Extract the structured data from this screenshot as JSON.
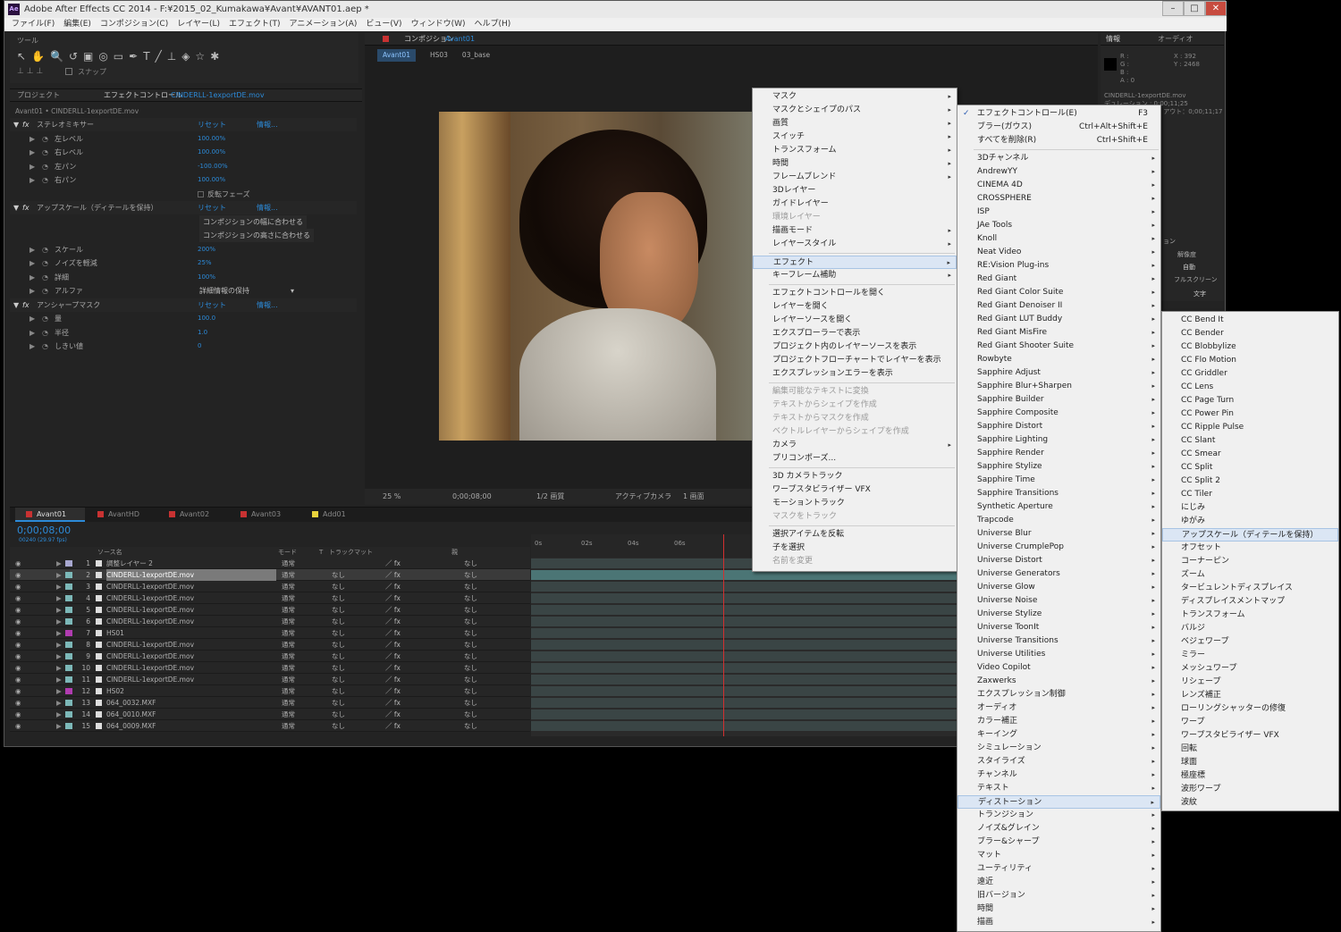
{
  "window": {
    "title": "Adobe After Effects CC 2014 - F:¥2015_02_Kumakawa¥Avant¥AVANT01.aep *",
    "logo": "Ae"
  },
  "menubar": [
    "ファイル(F)",
    "編集(E)",
    "コンポジション(C)",
    "レイヤー(L)",
    "エフェクト(T)",
    "アニメーション(A)",
    "ビュー(V)",
    "ウィンドウ(W)",
    "ヘルプ(H)"
  ],
  "tools": {
    "title": "ツール",
    "snap": "スナップ"
  },
  "project": {
    "tab": "プロジェクト",
    "effect_tab": "エフェクトコントロール",
    "effect_file": "CINDERLL-1exportDE.mov",
    "breadcrumb": "Avant01 • CINDERLL-1exportDE.mov"
  },
  "effects": {
    "reset": "リセット",
    "info": "情報...",
    "rows": [
      {
        "label": "ステレオミキサー",
        "value": "",
        "indent": 0,
        "fx": true
      },
      {
        "label": "左レベル",
        "value": "100.00%",
        "indent": 1
      },
      {
        "label": "右レベル",
        "value": "100.00%",
        "indent": 1
      },
      {
        "label": "左パン",
        "value": "-100.00%",
        "indent": 1
      },
      {
        "label": "右パン",
        "value": "100.00%",
        "indent": 1
      },
      {
        "label": "",
        "value": "反転フェーズ",
        "indent": 1,
        "check": true
      },
      {
        "label": "アップスケール（ディテールを保持）",
        "value": "",
        "indent": 0,
        "fx": true
      },
      {
        "label": "",
        "value": "コンポジションの幅に合わせる",
        "indent": 1,
        "btn": true
      },
      {
        "label": "",
        "value": "コンポジションの高さに合わせる",
        "indent": 1,
        "btn": true
      },
      {
        "label": "スケール",
        "value": "200%",
        "indent": 1
      },
      {
        "label": "ノイズを軽減",
        "value": "25%",
        "indent": 1
      },
      {
        "label": "詳細",
        "value": "100%",
        "indent": 1
      },
      {
        "label": "アルファ",
        "value": "詳細情報の保持",
        "indent": 1,
        "dropdown": true
      },
      {
        "label": "アンシャープマスク",
        "value": "",
        "indent": 0,
        "fx": true
      },
      {
        "label": "量",
        "value": "100.0",
        "indent": 1
      },
      {
        "label": "半径",
        "value": "1.0",
        "indent": 1
      },
      {
        "label": "しきい値",
        "value": "0",
        "indent": 1
      }
    ]
  },
  "comp": {
    "tab": "コンポジション",
    "name": "Avant01",
    "crumbs": [
      "Avant01",
      "HS03",
      "03_base"
    ],
    "zoom": "25 %",
    "time": "0;00;08;00",
    "res": "1/2 画質",
    "camera": "アクティブカメラ",
    "view": "1 画面"
  },
  "info": {
    "tab": "情報",
    "audio_tab": "オーディオ",
    "r": "R :",
    "g": "G :",
    "b": "B :",
    "a": "A : 0",
    "x": "X : 392",
    "y": "Y : 2468",
    "file": "CINDERLL-1exportDE.mov",
    "dur": "デュレーション : 0;00;11;25",
    "in_out": "イン：0;00;00;00、アウト：0;00;11;17",
    "t1": "ョン",
    "t2": "解像度",
    "t3": "自動",
    "t4": "フルスクリーン",
    "text_tab": "文字"
  },
  "timeline": {
    "tabs": [
      "Avant01",
      "AvantHD",
      "Avant02",
      "Avant03",
      "Add01"
    ],
    "tab_colors": [
      "#c83232",
      "#c83232",
      "#c83232",
      "#c83232",
      "#e8d23c"
    ],
    "timecode": "0;00;08;00",
    "fps": "00240 (29.97 fps)",
    "cols": {
      "name": "ソース名",
      "mode": "モード",
      "t": "T",
      "track": "トラックマット",
      "parent": "親"
    },
    "ruler": [
      "0s",
      "02s",
      "04s",
      "06s"
    ],
    "layers": [
      {
        "n": "1",
        "name": "調整レイヤー 2",
        "mode": "通常",
        "track": "",
        "parent": "なし",
        "color": "#a8a8d0"
      },
      {
        "n": "2",
        "name": "CINDERLL-1exportDE.mov",
        "mode": "通常",
        "track": "なし",
        "parent": "なし",
        "color": "#7cb8b8",
        "sel": true
      },
      {
        "n": "3",
        "name": "CINDERLL-1exportDE.mov",
        "mode": "通常",
        "track": "なし",
        "parent": "なし",
        "color": "#7cb8b8"
      },
      {
        "n": "4",
        "name": "CINDERLL-1exportDE.mov",
        "mode": "通常",
        "track": "なし",
        "parent": "なし",
        "color": "#7cb8b8"
      },
      {
        "n": "5",
        "name": "CINDERLL-1exportDE.mov",
        "mode": "通常",
        "track": "なし",
        "parent": "なし",
        "color": "#7cb8b8"
      },
      {
        "n": "6",
        "name": "CINDERLL-1exportDE.mov",
        "mode": "通常",
        "track": "なし",
        "parent": "なし",
        "color": "#7cb8b8"
      },
      {
        "n": "7",
        "name": "HS01",
        "mode": "通常",
        "track": "なし",
        "parent": "なし",
        "color": "#b03cb0"
      },
      {
        "n": "8",
        "name": "CINDERLL-1exportDE.mov",
        "mode": "通常",
        "track": "なし",
        "parent": "なし",
        "color": "#7cb8b8"
      },
      {
        "n": "9",
        "name": "CINDERLL-1exportDE.mov",
        "mode": "通常",
        "track": "なし",
        "parent": "なし",
        "color": "#7cb8b8"
      },
      {
        "n": "10",
        "name": "CINDERLL-1exportDE.mov",
        "mode": "通常",
        "track": "なし",
        "parent": "なし",
        "color": "#7cb8b8"
      },
      {
        "n": "11",
        "name": "CINDERLL-1exportDE.mov",
        "mode": "通常",
        "track": "なし",
        "parent": "なし",
        "color": "#7cb8b8"
      },
      {
        "n": "12",
        "name": "HS02",
        "mode": "通常",
        "track": "なし",
        "parent": "なし",
        "color": "#b03cb0"
      },
      {
        "n": "13",
        "name": "064_0032.MXF",
        "mode": "通常",
        "track": "なし",
        "parent": "なし",
        "color": "#7cb8b8"
      },
      {
        "n": "14",
        "name": "064_0010.MXF",
        "mode": "通常",
        "track": "なし",
        "parent": "なし",
        "color": "#7cb8b8"
      },
      {
        "n": "15",
        "name": "064_0009.MXF",
        "mode": "通常",
        "track": "なし",
        "parent": "なし",
        "color": "#7cb8b8"
      }
    ]
  },
  "menu1": [
    {
      "label": "マスク",
      "sub": true
    },
    {
      "label": "マスクとシェイプのパス",
      "sub": true
    },
    {
      "label": "画質",
      "sub": true
    },
    {
      "label": "スイッチ",
      "sub": true
    },
    {
      "label": "トランスフォーム",
      "sub": true
    },
    {
      "label": "時間",
      "sub": true
    },
    {
      "label": "フレームブレンド",
      "sub": true
    },
    {
      "label": "3Dレイヤー"
    },
    {
      "label": "ガイドレイヤー"
    },
    {
      "label": "環境レイヤー",
      "dis": true
    },
    {
      "label": "描画モード",
      "sub": true
    },
    {
      "label": "レイヤースタイル",
      "sub": true
    },
    {
      "sep": true
    },
    {
      "label": "エフェクト",
      "sub": true,
      "hl": true
    },
    {
      "label": "キーフレーム補助",
      "sub": true
    },
    {
      "sep": true
    },
    {
      "label": "エフェクトコントロールを開く"
    },
    {
      "label": "レイヤーを開く"
    },
    {
      "label": "レイヤーソースを開く"
    },
    {
      "label": "エクスプローラーで表示"
    },
    {
      "label": "プロジェクト内のレイヤーソースを表示"
    },
    {
      "label": "プロジェクトフローチャートでレイヤーを表示"
    },
    {
      "label": "エクスプレッションエラーを表示"
    },
    {
      "sep": true
    },
    {
      "label": "編集可能なテキストに変換",
      "dis": true
    },
    {
      "label": "テキストからシェイプを作成",
      "dis": true
    },
    {
      "label": "テキストからマスクを作成",
      "dis": true
    },
    {
      "label": "ベクトルレイヤーからシェイプを作成",
      "dis": true
    },
    {
      "label": "カメラ",
      "sub": true
    },
    {
      "label": "プリコンポーズ..."
    },
    {
      "sep": true
    },
    {
      "label": "3D カメラトラック"
    },
    {
      "label": "ワープスタビライザー VFX"
    },
    {
      "label": "モーショントラック"
    },
    {
      "label": "マスクをトラック",
      "dis": true
    },
    {
      "sep": true
    },
    {
      "label": "選択アイテムを反転"
    },
    {
      "label": "子を選択"
    },
    {
      "label": "名前を変更",
      "dis": true
    }
  ],
  "menu2": [
    {
      "label": "エフェクトコントロール(E)",
      "key": "F3",
      "check": true
    },
    {
      "label": "ブラー(ガウス)",
      "key": "Ctrl+Alt+Shift+E"
    },
    {
      "label": "すべてを削除(R)",
      "key": "Ctrl+Shift+E"
    },
    {
      "sep": true
    },
    {
      "label": "3Dチャンネル",
      "sub": true
    },
    {
      "label": "AndrewYY",
      "sub": true
    },
    {
      "label": "CINEMA 4D",
      "sub": true
    },
    {
      "label": "CROSSPHERE",
      "sub": true
    },
    {
      "label": "ISP",
      "sub": true
    },
    {
      "label": "JAe Tools",
      "sub": true
    },
    {
      "label": "Knoll",
      "sub": true
    },
    {
      "label": "Neat Video",
      "sub": true
    },
    {
      "label": "RE:Vision Plug-ins",
      "sub": true
    },
    {
      "label": "Red Giant",
      "sub": true
    },
    {
      "label": "Red Giant Color Suite",
      "sub": true
    },
    {
      "label": "Red Giant Denoiser II",
      "sub": true
    },
    {
      "label": "Red Giant LUT Buddy",
      "sub": true
    },
    {
      "label": "Red Giant MisFire",
      "sub": true
    },
    {
      "label": "Red Giant Shooter Suite",
      "sub": true
    },
    {
      "label": "Rowbyte",
      "sub": true
    },
    {
      "label": "Sapphire Adjust",
      "sub": true
    },
    {
      "label": "Sapphire Blur+Sharpen",
      "sub": true
    },
    {
      "label": "Sapphire Builder",
      "sub": true
    },
    {
      "label": "Sapphire Composite",
      "sub": true
    },
    {
      "label": "Sapphire Distort",
      "sub": true
    },
    {
      "label": "Sapphire Lighting",
      "sub": true
    },
    {
      "label": "Sapphire Render",
      "sub": true
    },
    {
      "label": "Sapphire Stylize",
      "sub": true
    },
    {
      "label": "Sapphire Time",
      "sub": true
    },
    {
      "label": "Sapphire Transitions",
      "sub": true
    },
    {
      "label": "Synthetic Aperture",
      "sub": true
    },
    {
      "label": "Trapcode",
      "sub": true
    },
    {
      "label": "Universe Blur",
      "sub": true
    },
    {
      "label": "Universe CrumplePop",
      "sub": true
    },
    {
      "label": "Universe Distort",
      "sub": true
    },
    {
      "label": "Universe Generators",
      "sub": true
    },
    {
      "label": "Universe Glow",
      "sub": true
    },
    {
      "label": "Universe Noise",
      "sub": true
    },
    {
      "label": "Universe Stylize",
      "sub": true
    },
    {
      "label": "Universe ToonIt",
      "sub": true
    },
    {
      "label": "Universe Transitions",
      "sub": true
    },
    {
      "label": "Universe Utilities",
      "sub": true
    },
    {
      "label": "Video Copilot",
      "sub": true
    },
    {
      "label": "Zaxwerks",
      "sub": true
    },
    {
      "label": "エクスプレッション制御",
      "sub": true
    },
    {
      "label": "オーディオ",
      "sub": true
    },
    {
      "label": "カラー補正",
      "sub": true
    },
    {
      "label": "キーイング",
      "sub": true
    },
    {
      "label": "シミュレーション",
      "sub": true
    },
    {
      "label": "スタイライズ",
      "sub": true
    },
    {
      "label": "チャンネル",
      "sub": true
    },
    {
      "label": "テキスト",
      "sub": true
    },
    {
      "label": "ディストーション",
      "sub": true,
      "hl": true
    },
    {
      "label": "トランジション",
      "sub": true
    },
    {
      "label": "ノイズ&グレイン",
      "sub": true
    },
    {
      "label": "ブラー&シャープ",
      "sub": true
    },
    {
      "label": "マット",
      "sub": true
    },
    {
      "label": "ユーティリティ",
      "sub": true
    },
    {
      "label": "遠近",
      "sub": true
    },
    {
      "label": "旧バージョン",
      "sub": true
    },
    {
      "label": "時間",
      "sub": true
    },
    {
      "label": "描画",
      "sub": true
    }
  ],
  "menu3": [
    {
      "label": "CC Bend It"
    },
    {
      "label": "CC Bender"
    },
    {
      "label": "CC Blobbylize"
    },
    {
      "label": "CC Flo Motion"
    },
    {
      "label": "CC Griddler"
    },
    {
      "label": "CC Lens"
    },
    {
      "label": "CC Page Turn"
    },
    {
      "label": "CC Power Pin"
    },
    {
      "label": "CC Ripple Pulse"
    },
    {
      "label": "CC Slant"
    },
    {
      "label": "CC Smear"
    },
    {
      "label": "CC Split"
    },
    {
      "label": "CC Split 2"
    },
    {
      "label": "CC Tiler"
    },
    {
      "label": "にじみ"
    },
    {
      "label": "ゆがみ"
    },
    {
      "label": "アップスケール（ディテールを保持）",
      "hl": true
    },
    {
      "label": "オフセット"
    },
    {
      "label": "コーナーピン"
    },
    {
      "label": "ズーム"
    },
    {
      "label": "タービュレントディスプレイス"
    },
    {
      "label": "ディスプレイスメントマップ"
    },
    {
      "label": "トランスフォーム"
    },
    {
      "label": "バルジ"
    },
    {
      "label": "ベジェワープ"
    },
    {
      "label": "ミラー"
    },
    {
      "label": "メッシュワープ"
    },
    {
      "label": "リシェープ"
    },
    {
      "label": "レンズ補正"
    },
    {
      "label": "ローリングシャッターの修復"
    },
    {
      "label": "ワープ"
    },
    {
      "label": "ワープスタビライザー VFX"
    },
    {
      "label": "回転"
    },
    {
      "label": "球面"
    },
    {
      "label": "極座標"
    },
    {
      "label": "波形ワープ"
    },
    {
      "label": "波紋"
    }
  ]
}
